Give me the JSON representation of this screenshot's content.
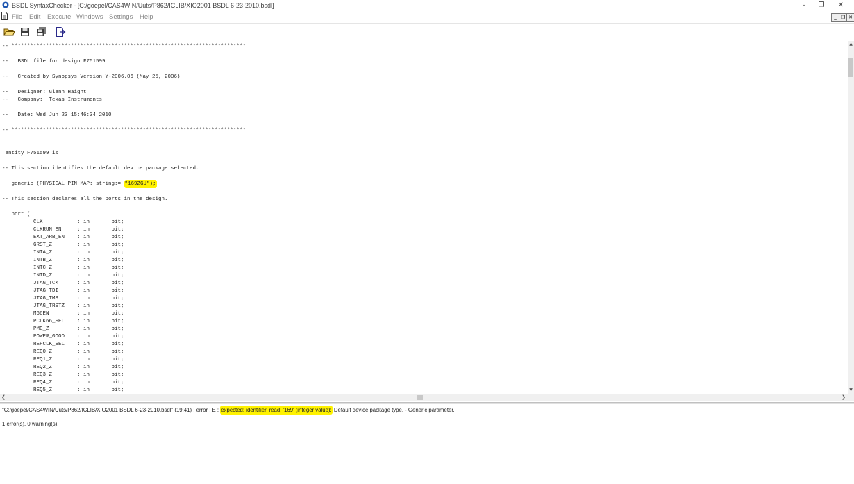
{
  "window": {
    "title": "BSDL SyntaxChecker - [C:/goepel/CAS4WIN/Uuts/P862/ICLIB/XIO2001 BSDL 6-23-2010.bsdl]",
    "minimize": "–",
    "restore": "❐",
    "close": "✕"
  },
  "menu": {
    "file": "File",
    "edit": "Edit",
    "execute": "Execute",
    "windows": "Windows",
    "settings": "Settings",
    "help": "Help"
  },
  "editor": {
    "lines_before": [
      "-- ***************************************************************************",
      "",
      "--   BSDL file for design F751599",
      "",
      "--   Created by Synopsys Version Y-2006.06 (May 25, 2006)",
      "",
      "--   Designer: Glenn Haight",
      "--   Company:  Texas Instruments",
      "",
      "--   Date: Wed Jun 23 15:46:34 2010",
      "",
      "-- ***************************************************************************",
      "",
      "",
      " entity F751599 is",
      "",
      "-- This section identifies the default device package selected.",
      ""
    ],
    "generic_prefix": "   generic (PHYSICAL_PIN_MAP: string:= ",
    "generic_highlight": "\"169ZGU\");",
    "lines_after": [
      "",
      "-- This section declares all the ports in the design.",
      "",
      "   port (",
      "          CLK           : in       bit;",
      "          CLKRUN_EN     : in       bit;",
      "          EXT_ARB_EN    : in       bit;",
      "          GRST_Z        : in       bit;",
      "          INTA_Z        : in       bit;",
      "          INTB_Z        : in       bit;",
      "          INTC_Z        : in       bit;",
      "          INTD_Z        : in       bit;",
      "          JTAG_TCK      : in       bit;",
      "          JTAG_TDI      : in       bit;",
      "          JTAG_TMS      : in       bit;",
      "          JTAG_TRSTZ    : in       bit;",
      "          M66EN         : in       bit;",
      "          PCLK66_SEL    : in       bit;",
      "          PME_Z         : in       bit;",
      "          POWER_GOOD    : in       bit;",
      "          REFCLK_SEL    : in       bit;",
      "          REQ0_Z        : in       bit;",
      "          REQ1_Z        : in       bit;",
      "          REQ2_Z        : in       bit;",
      "          REQ3_Z        : in       bit;",
      "          REQ4_Z        : in       bit;",
      "          REQ5_Z        : in       bit;"
    ]
  },
  "output": {
    "error_prefix": "\"C:/goepel/CAS4WIN/Uuts/P862/ICLIB/XIO2001 BSDL 6-23-2010.bsdl\" (19:41) : error : E :",
    "error_highlight": "expected: identifier, read: '169' (integer value);",
    "error_suffix": "Default device package type. - Generic parameter.",
    "summary": "1 error(s), 0 warning(s)."
  },
  "colors": {
    "highlight": "#fff200"
  }
}
